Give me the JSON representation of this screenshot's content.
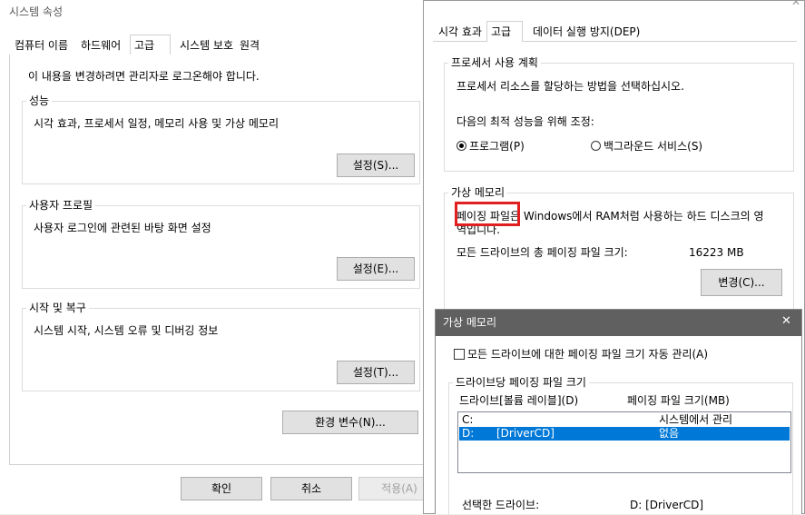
{
  "system_properties": {
    "title": "시스템 속성",
    "tabs": [
      "컴퓨터 이름",
      "하드웨어",
      "고급",
      "시스템 보호",
      "원격"
    ],
    "admin_note": "이 내용을 변경하려면 관리자로 로그온해야 합니다.",
    "performance": {
      "label": "성능",
      "desc": "시각 효과, 프로세서 일정, 메모리 사용 및 가상 메모리",
      "button": "설정(S)..."
    },
    "user_profile": {
      "label": "사용자 프로필",
      "desc": "사용자 로그인에 관련된 바탕 화면 설정",
      "button": "설정(E)..."
    },
    "startup": {
      "label": "시작 및 복구",
      "desc": "시스템 시작, 시스템 오류 및 디버깅 정보",
      "button": "설정(T)..."
    },
    "env_button": "환경 변수(N)...",
    "ok": "확인",
    "cancel": "취소",
    "apply": "적용(A)"
  },
  "performance_options": {
    "tabs": [
      "시각 효과",
      "고급",
      "데이터 실행 방지(DEP)"
    ],
    "processor": {
      "label": "프로세서 사용 계획",
      "desc": "프로세서 리소스를 할당하는 방법을 선택하십시오.",
      "adjust": "다음의 최적 성능을 위해 조정:",
      "program": "프로그램(P)",
      "background": "백그라운드 서비스(S)"
    },
    "virtual_memory": {
      "label": "가상 메모리",
      "desc_part1": "페이징 파일",
      "desc_part2": "은 Windows에서 RAM처럼 사용하는 하드 디스크의 영",
      "desc_line2": "역입니다.",
      "total_label": "모든 드라이브의 총 페이징 파일 크기:",
      "total_value": "16223 MB",
      "change_button": "변경(C)..."
    }
  },
  "virtual_memory_dialog": {
    "title": "가상 메모리",
    "close": "✕",
    "auto_manage": "모든 드라이브에 대한 페이징 파일 크기 자동 관리(A)",
    "group_label": "드라이브당 페이징 파일 크기",
    "col_drive": "드라이브[볼륨 레이블](D)",
    "col_size": "페이징 파일 크기(MB)",
    "drives": [
      {
        "drive": "C:",
        "label": "",
        "size": "시스템에서 관리"
      },
      {
        "drive": "D:",
        "label": "[DriverCD]",
        "size": "없음"
      }
    ],
    "selected_label": "선택한 드라이브:",
    "selected_value": "D:  [DriverCD]"
  },
  "colors": {
    "highlight": "#e02020",
    "selection": "#0078d7"
  }
}
